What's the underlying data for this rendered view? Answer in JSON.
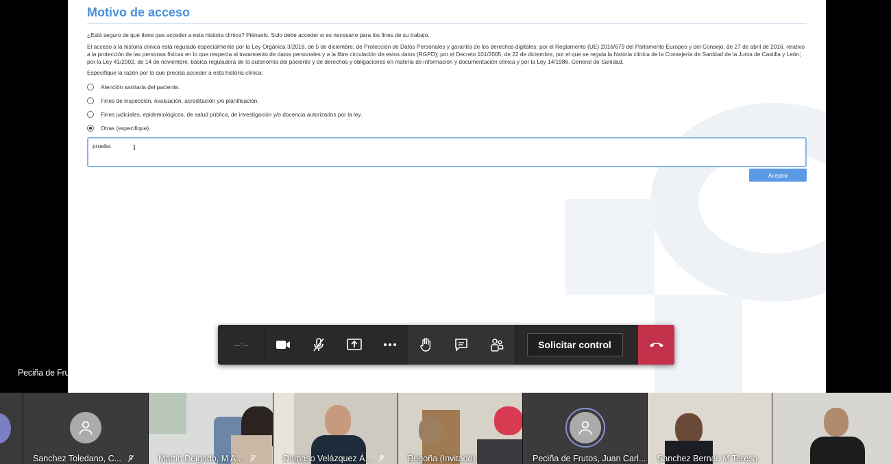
{
  "shared_screen": {
    "title": "Motivo de acceso",
    "question": "¿Está seguro de que tiene que acceder a esta historia clínica? Piénselo. Solo debe acceder si es necesario para los fines de su trabajo.",
    "legal_text": "El acceso a la historia clínica está regulado especialmente por la Ley Orgánica 3/2018, de 5 de diciembre, de Protección de Datos Personales y garantía de los derechos digitales; por el Reglamento (UE) 2016/679 del Parlamento Europeo y del Consejo, de 27 de abril de 2016, relativo a la protección de las personas físicas en lo que respecta al tratamiento de datos personales y a la libre circulación de estos datos (RGPD); por el Decreto 101/2005, de 22 de diciembre, por el que se regula la historia clínica de la Consejería de Sanidad de la Junta de Castilla y León; por la Ley 41/2002, de 14 de noviembre, básica reguladora de la autonomía del paciente y de derechos y obligaciones en materia de información y documentación clínica y por la Ley 14/1986, General de Sanidad.",
    "specify_label": "Especifique la razón por la que precisa acceder a esta historia clínica:",
    "options": [
      {
        "label": "Atención sanitaria del paciente.",
        "selected": false
      },
      {
        "label": "Fines de inspección, evaluación, acreditación y/o planificación.",
        "selected": false
      },
      {
        "label": "Fines judiciales, epidemiológicos, de salud pública, de investigación y/o docencia autorizados por la ley.",
        "selected": false
      },
      {
        "label": "Otras (especifique).",
        "selected": true
      }
    ],
    "other_value": "prueba",
    "accept_label": "Aceptar"
  },
  "toolbar": {
    "timer": "--:--",
    "request_control_label": "Solicitar control"
  },
  "presenter_name": "Peciña de Frutos, Juan Carlos",
  "participants": [
    {
      "name": "Sanchez Toledano, C..."
    },
    {
      "name": "Martin Delgado, M A..."
    },
    {
      "name": "Dámaso Velázquez Á..."
    },
    {
      "name": "Begoña (Invitado)"
    },
    {
      "name": "Peciña de Frutos, Juan Carl..."
    },
    {
      "name": "Sanchez Bernal, M Teresa"
    }
  ],
  "colors": {
    "accent": "#4a90d9",
    "hangup": "#c4314b",
    "toolbar": "#292929"
  }
}
